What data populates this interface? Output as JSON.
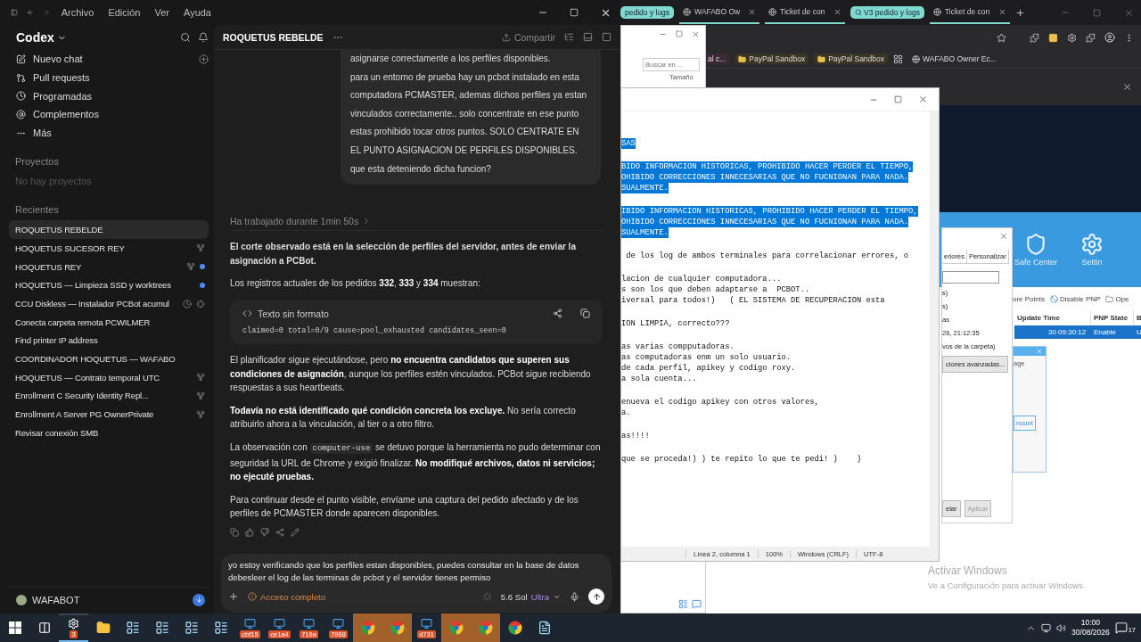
{
  "codex": {
    "menu": [
      "Archivo",
      "Edición",
      "Ver",
      "Ayuda"
    ],
    "app_name": "Codex",
    "nav": [
      {
        "kind": "new",
        "label": "Nuevo chat"
      },
      {
        "kind": "pull",
        "label": "Pull requests"
      },
      {
        "kind": "scheduled",
        "label": "Programadas"
      },
      {
        "kind": "plugins",
        "label": "Complementos"
      },
      {
        "kind": "more",
        "label": "Más"
      }
    ],
    "projects_heading": "Proyectos",
    "projects_empty": "No hay proyectos",
    "recents_heading": "Recientes",
    "recents": [
      {
        "title": "ROQUETUS REBELDE",
        "selected": true,
        "worktree": false,
        "unread": false,
        "scheduled": false,
        "running": false
      },
      {
        "title": "HOQUETUS SUCESOR REY",
        "selected": false,
        "worktree": true,
        "unread": false,
        "scheduled": false,
        "running": false
      },
      {
        "title": "HOQUETUS REY",
        "selected": false,
        "worktree": true,
        "unread": true,
        "scheduled": false,
        "running": false
      },
      {
        "title": "HOQUETUS — Limpieza SSD y worktrees",
        "selected": false,
        "worktree": false,
        "unread": true,
        "scheduled": false,
        "running": false
      },
      {
        "title": "CCU Diskless — Instalador PCBot acumul",
        "selected": false,
        "worktree": false,
        "unread": false,
        "scheduled": true,
        "running": true
      },
      {
        "title": "Conecta carpeta remota PCWILMER",
        "selected": false,
        "worktree": false,
        "unread": false,
        "scheduled": false,
        "running": false
      },
      {
        "title": "Find printer IP address",
        "selected": false,
        "worktree": false,
        "unread": false,
        "scheduled": false,
        "running": false
      },
      {
        "title": "COORDINADOR HOQUETUS — WAFABO",
        "selected": false,
        "worktree": false,
        "unread": false,
        "scheduled": false,
        "running": false
      },
      {
        "title": "HOQUETUS — Contrato temporal UTC",
        "selected": false,
        "worktree": true,
        "unread": false,
        "scheduled": false,
        "running": false
      },
      {
        "title": "Enrollment C Security Identity Repl...",
        "selected": false,
        "worktree": true,
        "unread": false,
        "scheduled": false,
        "running": false
      },
      {
        "title": "Enrollment A Server PG OwnerPrivate",
        "selected": false,
        "worktree": true,
        "unread": false,
        "scheduled": false,
        "running": false
      },
      {
        "title": "Revisar conexión SMB",
        "selected": false,
        "worktree": false,
        "unread": false,
        "scheduled": false,
        "running": false
      }
    ],
    "user": "WAFABOT",
    "chat": {
      "title": "ROQUETUS REBELDE",
      "share": "Compartir",
      "user_message": [
        "asignarse correctamente a los perfiles disponibles.",
        "para un entorno de prueba hay un pcbot instalado en esta computadora  PCMASTER, ademas dichos perfiles ya estan vinculados correctamente.. solo concentrate en ese punto estas prohibido tocar otros puntos. SOLO CENTRATE EN EL PUNTO ASIGNACION DE PERFILES DISPONIBLES. que esta deteniendo dicha funcion?"
      ],
      "worked": "Ha trabajado durante 1min 50s",
      "response": [
        {
          "kind": "lead",
          "parts": [
            {
              "kind": "text",
              "text": "El corte observado está en la selección de perfiles del servidor, antes de enviar la asignación a PCBot."
            }
          ]
        },
        {
          "kind": "text",
          "parts": [
            {
              "kind": "text",
              "text": "Los registros actuales de los pedidos **332**, **333** y **334** muestran:"
            }
          ]
        },
        {
          "kind": "code_block",
          "label": "Texto sin formato",
          "code": "claimed=0 total=0/9 cause=pool_exhausted candidates_seen=0"
        },
        {
          "kind": "text",
          "parts": [
            {
              "kind": "text",
              "text": "El planificador sigue ejecutándose, pero **no encuentra candidatos que superen sus condiciones de asignación**, aunque los perfiles estén vinculados. PCBot sigue recibiendo respuestas a sus heartbeats."
            }
          ]
        },
        {
          "kind": "text",
          "parts": [
            {
              "kind": "text",
              "text": "**Todavía no está identificado qué condición concreta los excluye.** No sería correcto atribuirlo ahora a la vinculación, al tier o a otro filtro."
            }
          ]
        },
        {
          "kind": "text",
          "parts": [
            {
              "kind": "text",
              "text": "La observación con "
            },
            {
              "kind": "code",
              "text": "computer-use"
            },
            {
              "kind": "text",
              "text": " se detuvo porque la herramienta no pudo determinar con seguridad la URL de Chrome y exigió finalizar. **No modifiqué archivos, datos ni servicios; no ejecuté pruebas.**"
            }
          ]
        },
        {
          "kind": "text",
          "parts": [
            {
              "kind": "text",
              "text": "Para continuar desde el punto visible, envíame una captura del pedido afectado y de los perfiles de PCMASTER donde aparecen disponibles."
            }
          ]
        }
      ],
      "composer": {
        "value": "yo estoy verificando que los perfiles estan disponibles, puedes consultar en la base de datos debesleer el log de las terminas de pcbot y el servidor tienes permiso",
        "access": "Acceso completo",
        "model": "5.6 Sol",
        "effort": "Ultra"
      }
    }
  },
  "chrome": {
    "tabs": [
      {
        "kind": "group",
        "label": "pedido y logs"
      },
      {
        "kind": "tab",
        "label": "WAFABO Ow"
      },
      {
        "kind": "tab",
        "label": "Ticket de con"
      },
      {
        "kind": "group",
        "label": "V3 pedido y logs"
      },
      {
        "kind": "tab",
        "label": "Ticket de con"
      }
    ],
    "bookmarks": [
      {
        "kind": "tinted",
        "label": "al c..."
      },
      {
        "kind": "folder",
        "label": "PayPal Sandbox"
      },
      {
        "kind": "folder",
        "label": "PayPal Sandbox"
      },
      {
        "kind": "apps"
      },
      {
        "kind": "site",
        "label": "WAFABO Owner Ec..."
      }
    ]
  },
  "explorer": {
    "search": {
      "placeholder": "Buscar en ..."
    },
    "column": "Tamaño"
  },
  "notepad": {
    "blocks": [
      [
        {
          "text": "SAS",
          "selected": true
        }
      ],
      [
        {
          "text": "BIDO INFORMACION HISTORICAS, PROHIBIDO HACER PERDER EL TIEMPO,",
          "selected": true
        },
        {
          "text": "OHIBIDO CORRECCIONES INNECESARIAS QUE NO FUCNIONAN PARA NADA.",
          "selected": true
        },
        {
          "text": "SUALMENTE.",
          "selected": true
        }
      ],
      [
        {
          "text": "IBIDO INFORMACION HISTORICAS, PROHIBIDO HACER PERDER EL TIEMPO,",
          "selected": true
        },
        {
          "text": "OHIBIDO CORRECCIONES INNECESARIAS QUE NO FUCNIONAN PARA NADA.",
          "selected": true
        },
        {
          "text": "SUALMENTE.",
          "selected": true
        }
      ],
      [
        {
          "text": " de los log de ambos terminales para correlacionar errores, o",
          "selected": false
        }
      ],
      [
        {
          "text": "lacion de cualquier computadora...",
          "selected": false
        },
        {
          "text": "s son los que deben adaptarse a  PCBOT..",
          "selected": false
        },
        {
          "text": "iversal para todos!)   ( EL SISTEMA DE RECUPERACION esta",
          "selected": false
        }
      ],
      [
        {
          "text": "ION LIMPIA, correcto???",
          "selected": false
        }
      ],
      [
        {
          "text": "as varias compputadoras.",
          "selected": false
        },
        {
          "text": "as computadoras enm un solo usuario.",
          "selected": false
        },
        {
          "text": "de cada perfil, apikey y codigo roxy.",
          "selected": false
        },
        {
          "text": "a sola cuenta...",
          "selected": false
        }
      ],
      [
        {
          "text": "enueva el codigo apikey con otros valores,",
          "selected": false
        },
        {
          "text": "a.",
          "selected": false
        }
      ],
      [
        {
          "text": "as!!!!",
          "selected": false
        }
      ],
      [
        {
          "text": "que se proceda!) ) te repito lo que te pedi! )    )",
          "selected": false
        }
      ]
    ],
    "status": [
      "Línea 2, columna 1",
      "100%",
      "Windows (CRLF)",
      "UTF-8"
    ]
  },
  "properties": {
    "tabs": [
      "eriores",
      "Personalizar"
    ],
    "fragments": [
      "s)",
      "s)",
      "as"
    ],
    "date": "26, 21:12:35",
    "note": "vos de la carpeta)",
    "advanced": "ciones avanzadas...",
    "buttons": [
      {
        "label": "elar",
        "disabled": false
      },
      {
        "label": "Aplicar",
        "disabled": true
      }
    ]
  },
  "driver_tool": {
    "tools": [
      {
        "kind": "shield",
        "label": "Safe Center"
      },
      {
        "kind": "gear",
        "label": "Settin"
      }
    ],
    "toolbar": [
      {
        "kind": "none",
        "label": "ore Points"
      },
      {
        "kind": "ban",
        "label": "Disable PNP"
      },
      {
        "kind": "folder",
        "label": "Ope"
      }
    ],
    "columns": [
      "Update Time",
      "PNP State",
      "B"
    ],
    "row": {
      "cells": [
        "30 09:30:12",
        "Enable",
        "U"
      ],
      "selected": true
    }
  },
  "small_dialog": {
    "text": "age",
    "button": "nount"
  },
  "activation": {
    "title": "Activar Windows",
    "text": "Ve a Configuración para activar Windows."
  },
  "taskbar": {
    "items": [
      {
        "kind": "start",
        "selected": false,
        "flashing": false
      },
      {
        "kind": "taskview",
        "selected": false,
        "flashing": false
      },
      {
        "kind": "codex",
        "badge": "3",
        "selected": true,
        "flashing": false
      },
      {
        "kind": "folder",
        "selected": false,
        "flashing": false
      },
      {
        "kind": "app",
        "selected": false,
        "flashing": false
      },
      {
        "kind": "app",
        "selected": false,
        "flashing": false
      },
      {
        "kind": "app",
        "selected": false,
        "flashing": false
      },
      {
        "kind": "app",
        "selected": false,
        "flashing": false
      },
      {
        "kind": "remote",
        "badge": "cbf15",
        "selected": false,
        "flashing": false
      },
      {
        "kind": "remote",
        "badge": "ce1a4",
        "selected": false,
        "flashing": false
      },
      {
        "kind": "remote",
        "badge": "716a",
        "selected": false,
        "flashing": false
      },
      {
        "kind": "remote",
        "badge": "7968",
        "selected": false,
        "flashing": false
      },
      {
        "kind": "chrome",
        "selected": false,
        "flashing": true
      },
      {
        "kind": "chrome",
        "selected": false,
        "flashing": true
      },
      {
        "kind": "remote",
        "badge": "d731",
        "selected": false,
        "flashing": false
      },
      {
        "kind": "chrome",
        "selected": false,
        "flashing": true
      },
      {
        "kind": "chrome",
        "selected": false,
        "flashing": true
      },
      {
        "kind": "chrome",
        "selected": false,
        "flashing": false
      },
      {
        "kind": "notepad",
        "selected": false,
        "flashing": false
      }
    ],
    "time": "10:00",
    "date": "30/08/2026",
    "notifications": "17"
  }
}
